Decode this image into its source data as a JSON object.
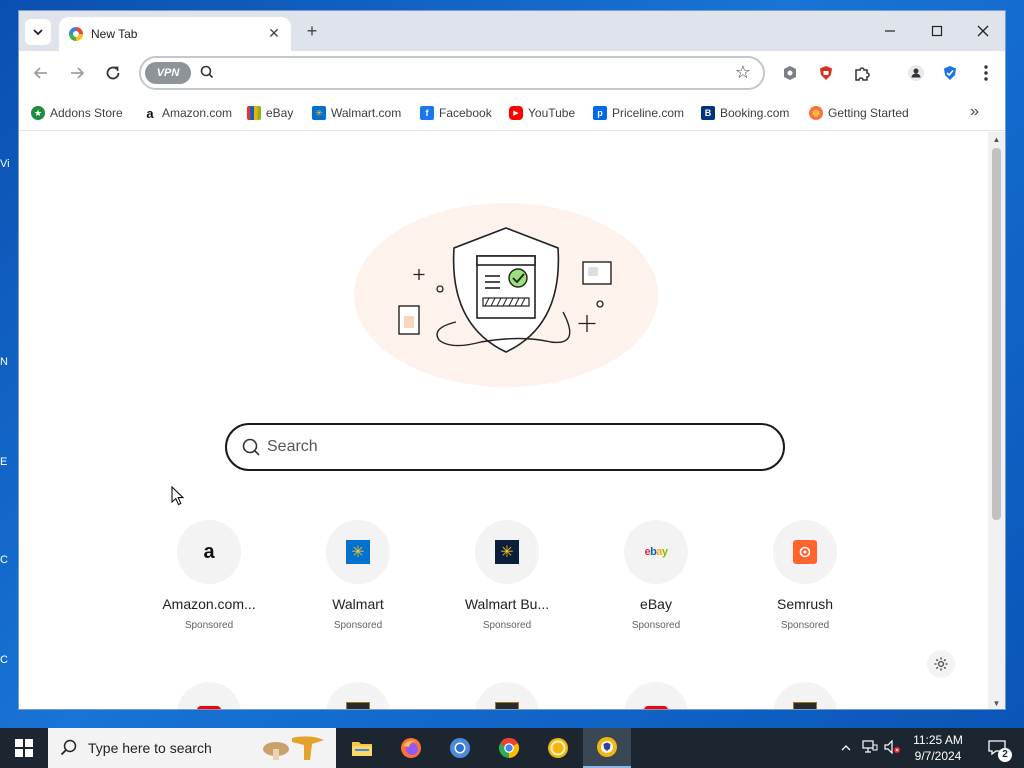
{
  "browser": {
    "tab": {
      "title": "New Tab"
    },
    "omnibox": {
      "vpn_label": "VPN",
      "placeholder": ""
    }
  },
  "bookmarks": [
    {
      "label": "Addons Store",
      "icon": "addons-store-icon",
      "color": "#1e8e3e"
    },
    {
      "label": "Amazon.com",
      "icon": "amazon-icon",
      "color": "#111111"
    },
    {
      "label": "eBay",
      "icon": "ebay-icon",
      "color": "#e53238"
    },
    {
      "label": "Walmart.com",
      "icon": "walmart-icon",
      "color": "#0071ce"
    },
    {
      "label": "Facebook",
      "icon": "facebook-icon",
      "color": "#1877f2"
    },
    {
      "label": "YouTube",
      "icon": "youtube-icon",
      "color": "#ff0000"
    },
    {
      "label": "Priceline.com",
      "icon": "priceline-icon",
      "color": "#0068ef"
    },
    {
      "label": "Booking.com",
      "icon": "booking-icon",
      "color": "#003580"
    },
    {
      "label": "Getting Started",
      "icon": "firefox-icon",
      "color": "#ff7139"
    }
  ],
  "newtab": {
    "search_placeholder": "Search",
    "tiles": [
      {
        "name": "Amazon.com...",
        "sponsor": "Sponsored",
        "icon": "amazon-icon"
      },
      {
        "name": "Walmart",
        "sponsor": "Sponsored",
        "icon": "walmart-icon"
      },
      {
        "name": "Walmart Bu...",
        "sponsor": "Sponsored",
        "icon": "walmart-business-icon"
      },
      {
        "name": "eBay",
        "sponsor": "Sponsored",
        "icon": "ebay-icon"
      },
      {
        "name": "Semrush",
        "sponsor": "Sponsored",
        "icon": "semrush-icon"
      }
    ]
  },
  "taskbar": {
    "search_placeholder": "Type here to search",
    "time": "11:25 AM",
    "date": "9/7/2024",
    "notification_count": "2"
  },
  "desktop_labels": [
    "Vi",
    "N",
    "E",
    "C",
    "C"
  ]
}
